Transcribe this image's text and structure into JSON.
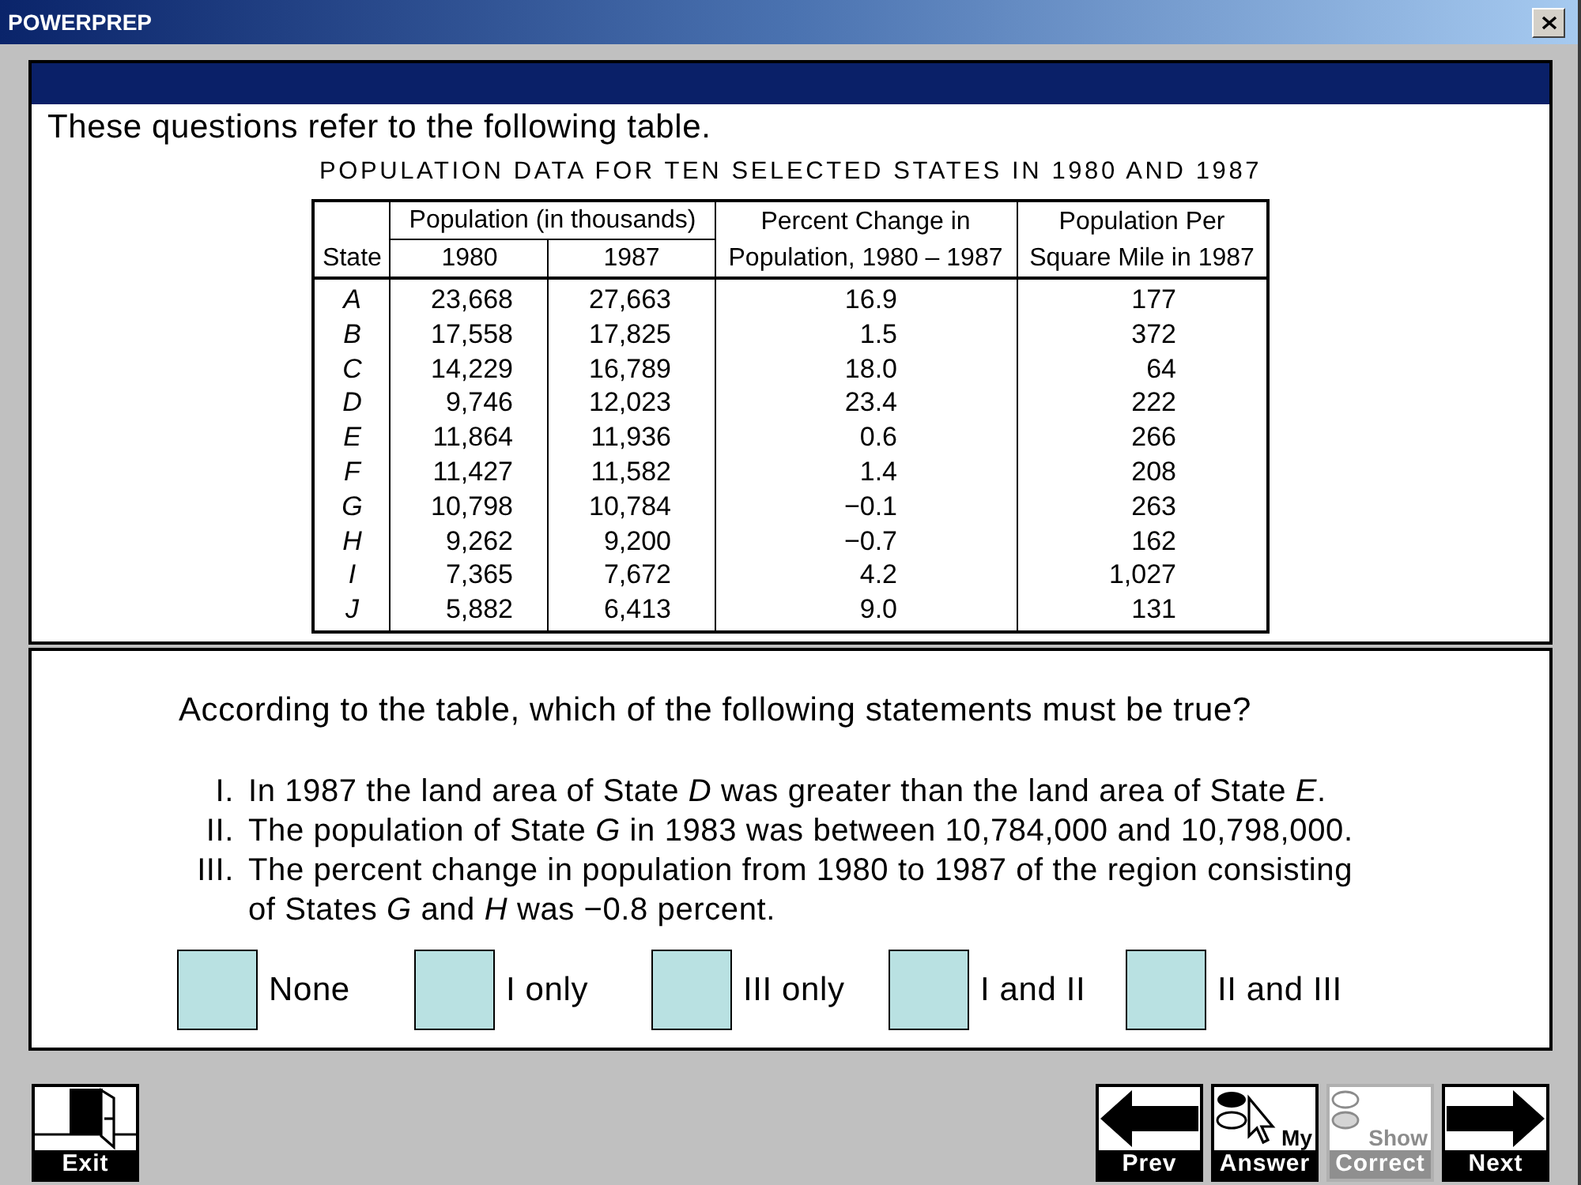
{
  "window": {
    "title": "POWERPREP"
  },
  "passage": {
    "intro": "These questions refer to the following table.",
    "table": {
      "title": "POPULATION DATA FOR TEN SELECTED STATES IN 1980 AND 1987",
      "header": {
        "state": "State",
        "population_group": "Population (in thousands)",
        "year_1980": "1980",
        "year_1987": "1987",
        "percent_change": [
          "Percent Change in",
          "Population, 1980 – 1987"
        ],
        "per_square_mile": [
          "Population Per",
          "Square Mile in 1987"
        ]
      },
      "rows": [
        [
          "A",
          "23,668",
          "27,663",
          "16.9",
          "177"
        ],
        [
          "B",
          "17,558",
          "17,825",
          "1.5",
          "372"
        ],
        [
          "C",
          "14,229",
          "16,789",
          "18.0",
          "64"
        ],
        [
          "D",
          "9,746",
          "12,023",
          "23.4",
          "222"
        ],
        [
          "E",
          "11,864",
          "11,936",
          "0.6",
          "266"
        ],
        [
          "F",
          "11,427",
          "11,582",
          "1.4",
          "208"
        ],
        [
          "G",
          "10,798",
          "10,784",
          "−0.1",
          "263"
        ],
        [
          "H",
          "9,262",
          "9,200",
          "−0.7",
          "162"
        ],
        [
          "I",
          "7,365",
          "7,672",
          "4.2",
          "1,027"
        ],
        [
          "J",
          "5,882",
          "6,413",
          "9.0",
          "131"
        ]
      ]
    }
  },
  "question": {
    "stem": "According to the table, which of the following statements must be true?",
    "statements": [
      {
        "numeral": "I.",
        "text": "In 1987 the land area of State *D* was greater than the land area of State *E*."
      },
      {
        "numeral": "II.",
        "text": "The population of State *G* in 1983 was between 10,784,000 and 10,798,000."
      },
      {
        "numeral": "III.",
        "text": "The percent change in population from 1980 to 1987 of the region consisting of States *G* and *H* was −0.8 percent."
      }
    ],
    "choices": [
      {
        "label": "None",
        "selected": false
      },
      {
        "label": "I only",
        "selected": false
      },
      {
        "label": "III only",
        "selected": false
      },
      {
        "label": "I and II",
        "selected": false
      },
      {
        "label": "II and III",
        "selected": false
      }
    ]
  },
  "toolbar": {
    "left": [
      {
        "kind": "exit",
        "label": "Exit",
        "disabled": false
      }
    ],
    "right": [
      {
        "kind": "prev",
        "label": "Prev",
        "disabled": false
      },
      {
        "kind": "my_answer",
        "caption": "My",
        "label": "Answer",
        "disabled": false
      },
      {
        "kind": "show_correct",
        "caption": "Show",
        "label": "Correct",
        "disabled": true
      },
      {
        "kind": "next",
        "label": "Next",
        "disabled": false
      }
    ]
  }
}
